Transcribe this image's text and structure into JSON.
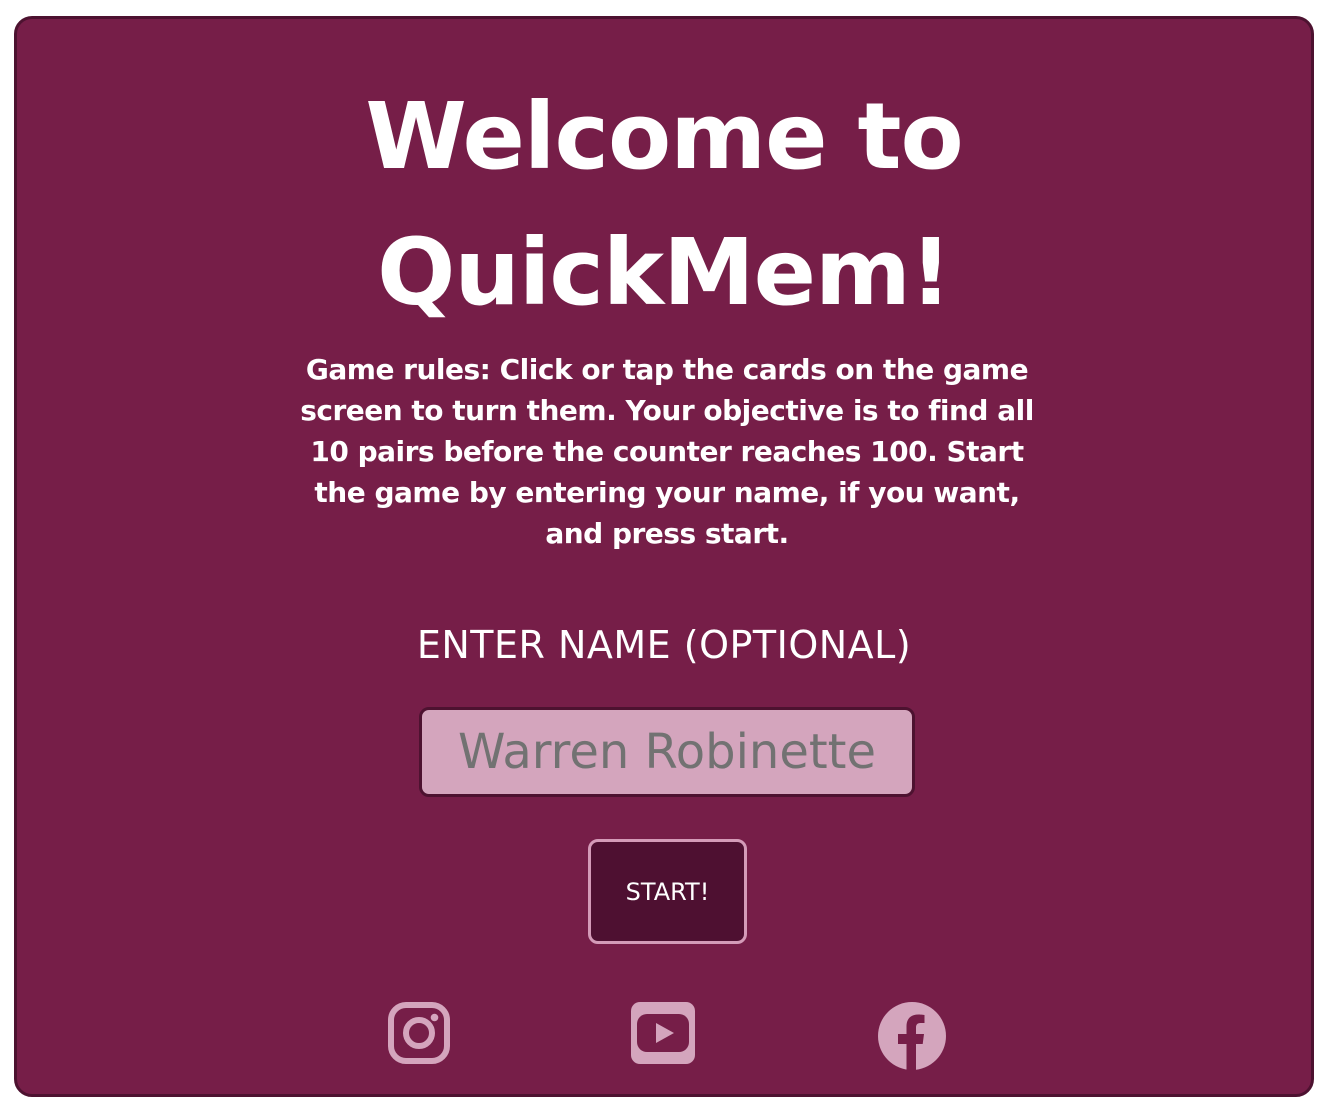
{
  "title": {
    "line1": "Welcome to",
    "line2": "QuickMem!"
  },
  "rules": {
    "text": "Game rules: Click or tap the cards on the game screen to turn them. Your objective is to find all 10 pairs before the counter reaches 100. Start the game by entering your name, if you want, and press start."
  },
  "name_field": {
    "label": "ENTER NAME (OPTIONAL)",
    "value": "Warren Robinette"
  },
  "start_button": {
    "label": "START!"
  },
  "social_links": [
    {
      "icon": "instagram-icon"
    },
    {
      "icon": "youtube-icon"
    },
    {
      "icon": "facebook-icon"
    }
  ],
  "colors": {
    "panel_background": "#761e48",
    "panel_border": "#4d1230",
    "input_background": "#d4a5bd",
    "input_text": "#727272",
    "button_background": "#4e1031",
    "button_border": "#d49bb8",
    "icon_color": "#d4a5bd",
    "text": "#ffffff"
  }
}
